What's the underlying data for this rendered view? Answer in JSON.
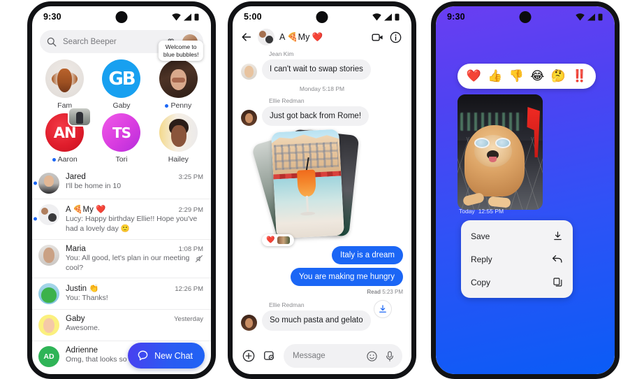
{
  "phone1": {
    "status": {
      "time": "9:30",
      "icons": [
        "wifi-icon",
        "signal-icon",
        "battery-icon"
      ]
    },
    "search": {
      "placeholder": "Search Beeper",
      "icon": "search-icon",
      "settings_icon": "gear-icon",
      "avatar": "profile-avatar"
    },
    "tiles": [
      {
        "name": "Fam",
        "unread": false,
        "art": "art-dog-fam",
        "tooltip": ""
      },
      {
        "name": "Gaby",
        "unread": false,
        "art": "art-gaby",
        "glyph": "GB",
        "tooltip": ""
      },
      {
        "name": "Penny",
        "unread": true,
        "art": "art-penny",
        "tooltip": "Welcome to blue bubbles!"
      },
      {
        "name": "Aaron",
        "unread": true,
        "art": "art-aaron",
        "glyph": "AN",
        "tooltip": ""
      },
      {
        "name": "Tori",
        "unread": false,
        "art": "art-tori",
        "glyph": "TS",
        "tooltip": ""
      },
      {
        "name": "Hailey",
        "unread": false,
        "art": "art-hailey",
        "tooltip": ""
      }
    ],
    "chats": [
      {
        "name": "Jared",
        "time": "3:25 PM",
        "message": "I'll be home in 10",
        "unread": true,
        "muted": false,
        "avatar": "av-jared",
        "initials": ""
      },
      {
        "name": "A 🍕My ❤️",
        "time": "2:29 PM",
        "message": "Lucy: Happy birthday Ellie!! Hope you've had a lovely day  🙂",
        "unread": true,
        "muted": false,
        "avatar": "av-group",
        "initials": ""
      },
      {
        "name": "Maria",
        "time": "1:08 PM",
        "message": "You: All good, let's plan in our meeting cool?",
        "unread": false,
        "muted": true,
        "avatar": "av-maria",
        "initials": ""
      },
      {
        "name": "Justin 👏",
        "time": "12:26 PM",
        "message": "You: Thanks!",
        "unread": false,
        "muted": false,
        "avatar": "av-justin",
        "initials": ""
      },
      {
        "name": "Gaby",
        "time": "Yesterday",
        "message": "Awesome.",
        "unread": false,
        "muted": false,
        "avatar": "av-gaby",
        "initials": ""
      },
      {
        "name": "Adrienne",
        "time": "",
        "message": "Omg, that looks so nice!",
        "unread": false,
        "muted": false,
        "avatar": "av-adrienne",
        "initials": "AD"
      }
    ],
    "fab": {
      "label": "New Chat",
      "icon": "chat-bubble-icon"
    }
  },
  "phone2": {
    "status": {
      "time": "5:00"
    },
    "header": {
      "back_icon": "back-arrow-icon",
      "title": "A 🍕My ❤️",
      "video_icon": "video-call-icon",
      "info_icon": "info-icon"
    },
    "messages": [
      {
        "type": "incoming",
        "sender": "Jean Kim",
        "text": "I can't wait to swap stories",
        "avatar": "av-jean"
      },
      {
        "type": "daystamp",
        "text": "Monday 5:18 PM"
      },
      {
        "type": "incoming",
        "sender": "Ellie Redman",
        "text": "Just got back from Rome!",
        "avatar": "av-ellie"
      },
      {
        "type": "photo-stack",
        "reaction": "❤️",
        "download_icon": "download-icon"
      },
      {
        "type": "outgoing",
        "text": "Italy is a dream"
      },
      {
        "type": "outgoing",
        "text": "You are making me hungry"
      },
      {
        "type": "receipt",
        "label": "Read",
        "time": "5:23 PM"
      },
      {
        "type": "incoming",
        "sender": "Ellie Redman",
        "text": "So much pasta and gelato",
        "avatar": "av-ellie"
      }
    ],
    "composer": {
      "plus_icon": "add-icon",
      "gallery_icon": "gallery-icon",
      "placeholder": "Message",
      "emoji_icon": "emoji-icon",
      "mic_icon": "microphone-icon"
    }
  },
  "phone3": {
    "status": {
      "time": "9:30"
    },
    "reactions": [
      "❤️",
      "👍",
      "👎",
      "😂",
      "🤔",
      "‼️"
    ],
    "media": {
      "caption_day": "Today",
      "caption_time": "12:55 PM",
      "alt": "dog-photo"
    },
    "menu": [
      {
        "label": "Save",
        "icon": "download-icon"
      },
      {
        "label": "Reply",
        "icon": "reply-arrow-icon"
      },
      {
        "label": "Copy",
        "icon": "copy-icon"
      }
    ],
    "colors": {
      "bg_top": "#6a3ef2",
      "bg_bottom": "#0a5cf6"
    }
  },
  "colors": {
    "accent_blue": "#1b66f5",
    "bubble_in": "#f1f1f3",
    "fab_gradient_start": "#4a3ff0",
    "fab_gradient_end": "#1f63f4"
  }
}
